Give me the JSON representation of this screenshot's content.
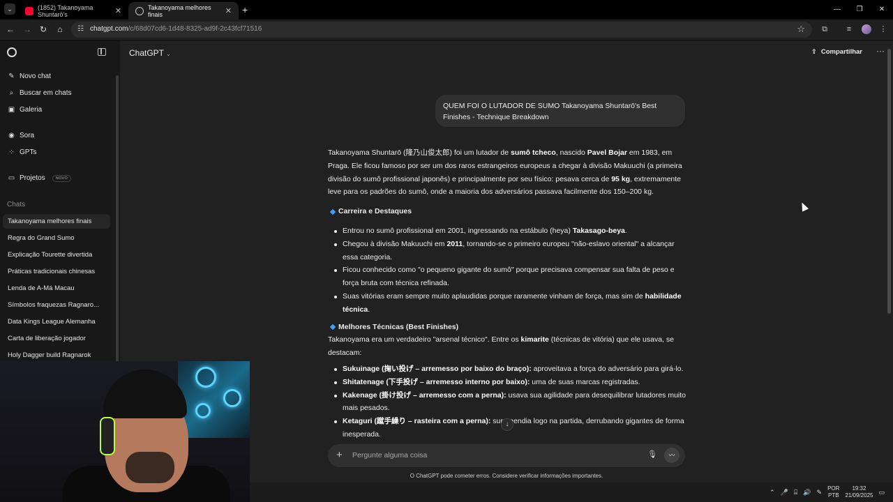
{
  "browser": {
    "tabs": [
      {
        "title": "(1852) Takanoyama Shuntarō's",
        "favicon_color": "#ff0033",
        "active": false
      },
      {
        "title": "Takanoyama melhores finais",
        "favicon_color": "#c9c9c9",
        "active": true
      }
    ],
    "url_host": "chatgpt.com",
    "url_path": "/c/68d07cd6-1d48-8325-ad9f-2c43fcf71516"
  },
  "sidebar": {
    "top_items": [
      {
        "label": "Novo chat",
        "icon": "edit-icon"
      },
      {
        "label": "Buscar em chats",
        "icon": "search-icon"
      },
      {
        "label": "Galeria",
        "icon": "image-icon"
      }
    ],
    "mid_items": [
      {
        "label": "Sora",
        "icon": "sora-icon"
      },
      {
        "label": "GPTs",
        "icon": "grid-icon"
      }
    ],
    "projects_label": "Projetos",
    "projects_badge": "NOVO",
    "chats_section": "Chats",
    "chats": [
      "Takanoyama melhores finais",
      "Regra do Grand Sumo",
      "Explicação Tourette divertida",
      "Práticas tradicionais chinesas",
      "Lenda de A-Má Macau",
      "Símbolos fraquezas Ragnaro...",
      "Data Kings League Alemanha",
      "Carta de liberação jogador",
      "Holy Dagger build Ragnarok"
    ]
  },
  "header": {
    "model": "ChatGPT",
    "share": "Compartilhar"
  },
  "conversation": {
    "user_message": "QUEM FOI O LUTADOR DE SUMO Takanoyama Shuntarō's Best Finishes - Technique Breakdown",
    "intro": {
      "p1": "Takanoyama Shuntarō (隆乃山俊太郎) foi um lutador de ",
      "b1": "sumô tcheco",
      "p2": ", nascido ",
      "b2": "Pavel Bojar",
      "p3": " em 1983, em Praga. Ele ficou famoso por ser um dos raros estrangeiros europeus a chegar à divisão Makuuchi (a primeira divisão do sumô profissional japonês) e principalmente por seu físico: pesava cerca de ",
      "b3": "95 kg",
      "p4": ", extremamente leve para os padrões do sumô, onde a maioria dos adversários passava facilmente dos 150–200 kg."
    },
    "section1_title": "Carreira e Destaques",
    "section1_items": [
      {
        "pre": "Entrou no sumô profissional em 2001, ingressando na estábulo (heya) ",
        "bold": "Takasago-beya",
        "post": "."
      },
      {
        "pre": "Chegou à divisão Makuuchi em ",
        "bold": "2011",
        "post": ", tornando-se o primeiro europeu \"não-eslavo oriental\" a alcançar essa categoria."
      },
      {
        "pre": "Ficou conhecido como \"o pequeno gigante do sumô\" porque precisava compensar sua falta de peso e força bruta com técnica refinada.",
        "bold": "",
        "post": ""
      },
      {
        "pre": "Suas vitórias eram sempre muito aplaudidas porque raramente vinham de força, mas sim de ",
        "bold": "habilidade técnica",
        "post": "."
      }
    ],
    "section2_title": "Melhores Técnicas (Best Finishes)",
    "section2_intro": {
      "pre": "Takanoyama era um verdadeiro \"arsenal técnico\". Entre os ",
      "bold": "kimarite",
      "post": " (técnicas de vitória) que ele usava, se destacam:"
    },
    "section2_items": [
      {
        "bold": "Sukuinage (掬い投げ – arremesso por baixo do braço):",
        "post": " aproveitava a força do adversário para girá-lo."
      },
      {
        "bold": "Shitatenage (下手投げ – arremesso interno por baixo):",
        "post": " uma de suas marcas registradas."
      },
      {
        "bold": "Kakenage (掛け投げ – arremesso com a perna):",
        "post": " usava sua agilidade para desequilibrar lutadores muito mais pesados."
      },
      {
        "bold": "Ketaguri (蹴手繰り – rasteira com a perna):",
        "post": " surpreendia logo na partida, derrubando gigantes de forma inesperada."
      }
    ]
  },
  "composer": {
    "placeholder": "Pergunte alguma coisa",
    "disclaimer": "O ChatGPT pode cometer erros. Considere verificar informações importantes."
  },
  "taskbar": {
    "lang_line1": "POR",
    "lang_line2": "PTB",
    "time": "19:32",
    "date": "21/09/2025"
  }
}
